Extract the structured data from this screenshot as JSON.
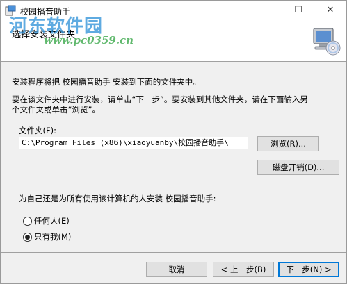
{
  "window": {
    "title": "校园播音助手",
    "controls": {
      "minimize": "—",
      "maximize": "☐",
      "close": "✕"
    }
  },
  "watermark": {
    "name": "河东软件园",
    "url": "www.pc0359.cn"
  },
  "header": {
    "title": "选择安装文件夹"
  },
  "body": {
    "intro": "安装程序将把 校园播音助手 安装到下面的文件夹中。",
    "instruction_line1": "要在该文件夹中进行安装，请单击“下一步”。要安装到其他文件夹，请在下面输入另一",
    "instruction_line2": "个文件夹或单击“浏览”。",
    "folder_label": "文件夹(F):",
    "folder_value": "C:\\Program Files (x86)\\xiaoyuanby\\校园播音助手\\",
    "browse_label": "浏览(R)...",
    "disk_cost_label": "磁盘开销(D)...",
    "install_for_label": "为自己还是为所有使用该计算机的人安装 校园播音助手:",
    "options": [
      {
        "label": "任何人(E)",
        "checked": false
      },
      {
        "label": "只有我(M)",
        "checked": true
      }
    ]
  },
  "footer": {
    "cancel_label": "取消",
    "back_label": "< 上一步(B)",
    "next_label": "下一步(N) >"
  }
}
